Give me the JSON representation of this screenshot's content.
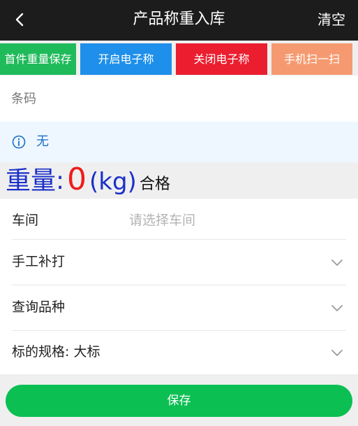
{
  "header": {
    "title": "产品称重入库",
    "right_action": "清空",
    "back_icon": "chevron-left-icon"
  },
  "toolbar": {
    "save_first_weight": "首件重量保存",
    "open_scale": "开启电子称",
    "close_scale": "关闭电子称",
    "scan": "手机扫一扫"
  },
  "barcode": {
    "placeholder": "条码",
    "value": ""
  },
  "info": {
    "icon": "info-icon",
    "text": "无"
  },
  "weight": {
    "label": "重量:",
    "value": "0",
    "unit": "(kg)",
    "status": "合格"
  },
  "form": {
    "workshop": {
      "label": "车间",
      "placeholder": "请选择车间"
    },
    "manual_print": {
      "label": "手工补打"
    },
    "query_variety": {
      "label": "查询品种"
    },
    "label_spec": {
      "label": "标的规格: 大标"
    }
  },
  "footer": {
    "save_label": "保存"
  },
  "colors": {
    "header_bg": "#1c1c1c",
    "green": "#1fba5a",
    "blue": "#1e8fea",
    "red": "#ea1e2f",
    "orange": "#f59a70",
    "save_green": "#0bbf52",
    "weight_blue": "#1b2fc9",
    "weight_red": "#ee1c1c"
  }
}
